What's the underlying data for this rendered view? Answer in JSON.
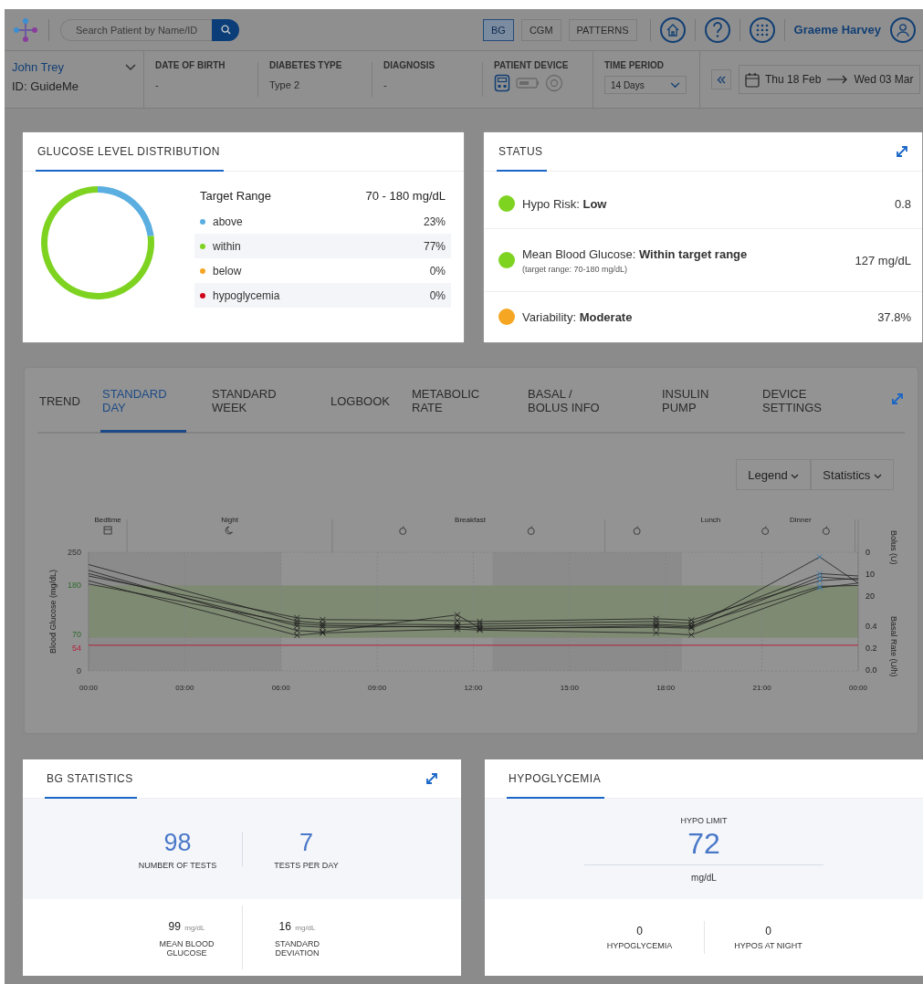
{
  "header": {
    "search": {
      "placeholder": "Search Patient by Name/ID"
    },
    "modes": [
      {
        "label": "BG",
        "selected": true
      },
      {
        "label": "CGM",
        "selected": false
      },
      {
        "label": "PATTERNS",
        "selected": false
      }
    ],
    "user": "Graeme Harvey"
  },
  "patient": {
    "name": "John Trey",
    "id": "ID: GuideMe",
    "fields": [
      {
        "label": "DATE OF BIRTH",
        "value": "-"
      },
      {
        "label": "DIABETES TYPE",
        "value": "Type 2"
      },
      {
        "label": "DIAGNOSIS",
        "value": "-"
      }
    ],
    "device_label": "PATIENT DEVICE",
    "devices": [
      {
        "kind": "meter",
        "active": true
      },
      {
        "kind": "pump",
        "active": false
      },
      {
        "kind": "sensor",
        "active": false
      }
    ],
    "time_period": {
      "label": "TIME PERIOD",
      "value": "14 Days"
    },
    "date_from": "Thu 18 Feb",
    "date_to": "Wed 03 Mar"
  },
  "distribution": {
    "title": "GLUCOSE LEVEL DISTRIBUTION",
    "target_label": "Target Range",
    "target_value": "70 - 180 mg/dL",
    "chart_data": {
      "type": "donut",
      "categories": [
        "above",
        "within",
        "below",
        "hypoglycemia"
      ],
      "series": [
        {
          "values": [
            23,
            77,
            0,
            0
          ]
        }
      ]
    },
    "items": [
      {
        "value": "23%",
        "color": "#5aaee0"
      },
      {
        "value": "77%",
        "color": "#7ed321"
      },
      {
        "value": "0%",
        "color": "#f5a623"
      },
      {
        "value": "0%",
        "color": "#d0021b"
      }
    ]
  },
  "status": {
    "title": "STATUS",
    "items": [
      {
        "label": "Hypo Risk: **Low**",
        "value": "0.8",
        "color": "#7ed321"
      },
      {
        "label": "Mean Blood Glucose: **Within target range**",
        "note": "(target range: 70-180 mg/dL)",
        "value": "127 mg/dL",
        "color": "#7ed321"
      },
      {
        "label": "Variability: **Moderate**",
        "value": "37.8%",
        "color": "#f5a623"
      }
    ]
  },
  "report": {
    "tabs": [
      {
        "label": "TREND",
        "selected": false
      },
      {
        "label": "STANDARD DAY",
        "selected": true
      },
      {
        "label": "STANDARD WEEK",
        "selected": false
      },
      {
        "label": "LOGBOOK",
        "selected": false
      },
      {
        "label": "METABOLIC RATE",
        "selected": false
      },
      {
        "label": "BASAL / BOLUS INFO",
        "selected": false
      },
      {
        "label": "INSULIN PUMP",
        "selected": false
      },
      {
        "label": "DEVICE SETTINGS",
        "selected": false
      }
    ],
    "dropdowns": [
      "Legend",
      "Statistics"
    ],
    "periods": [
      {
        "label": "Bedtime",
        "kind": "bed"
      },
      {
        "label": "Night",
        "kind": "moon"
      },
      {
        "label": "Breakfast",
        "kind": "meal"
      },
      {
        "label": "Lunch",
        "kind": "meal"
      },
      {
        "label": "Dinner",
        "kind": "meal"
      }
    ],
    "right_axis": {
      "bolus_label": "Bolus (U)",
      "bolus_ticks": [
        "0",
        "10",
        "20"
      ],
      "basal_label": "Basal Rate (U/h)",
      "basal_ticks": [
        "0.4",
        "0.2",
        "0.0"
      ]
    },
    "chart_data": {
      "type": "line",
      "ylabel": "Blood Glucose (mg/dL)",
      "x": [
        0,
        6.5,
        7.3,
        11.5,
        12.2,
        17.7,
        18.8,
        22.8,
        24
      ],
      "xticks": [
        {
          "value": 0,
          "label": "00:00"
        },
        {
          "value": 3,
          "label": "03:00"
        },
        {
          "value": 6,
          "label": "06:00"
        },
        {
          "value": 9,
          "label": "09:00"
        },
        {
          "value": 12,
          "label": "12:00"
        },
        {
          "value": 15,
          "label": "15:00"
        },
        {
          "value": 18,
          "label": "18:00"
        },
        {
          "value": 21,
          "label": "21:00"
        },
        {
          "value": 24,
          "label": "00:00"
        }
      ],
      "yticks": [
        0,
        54,
        70,
        180,
        250
      ],
      "ylim": [
        0,
        250
      ],
      "xlim": [
        0,
        24
      ],
      "grid": true,
      "bands": [
        {
          "axis": "x",
          "from": 0,
          "to": 6,
          "color": "#8b8b8b"
        },
        {
          "axis": "x",
          "from": 12.6,
          "to": 18.5,
          "color": "#8b8b8b"
        },
        {
          "axis": "y",
          "from": 70,
          "to": 180,
          "color": "#7f8a73"
        }
      ],
      "ref_lines": [
        {
          "axis": "y",
          "value": 54,
          "color": "#b3203a"
        }
      ],
      "series": [
        {
          "values": [
            224,
            105,
            100,
            97,
            99,
            104,
            100,
            205,
            200
          ]
        },
        {
          "values": [
            200,
            112,
            108,
            106,
            104,
            110,
            107,
            190,
            195
          ]
        },
        {
          "values": [
            205,
            95,
            92,
            94,
            88,
            95,
            92,
            240,
            185
          ]
        },
        {
          "values": [
            190,
            75,
            80,
            88,
            86,
            80,
            76,
            175,
            185
          ]
        },
        {
          "values": [
            183,
            100,
            96,
            92,
            94,
            98,
            95,
            178,
            180
          ]
        },
        {
          "values": [
            212,
            85,
            82,
            118,
            90,
            92,
            90,
            198,
            192
          ]
        }
      ]
    }
  },
  "bg_stats": {
    "title": "BG STATISTICS",
    "top": [
      {
        "value": "98",
        "label": "NUMBER OF TESTS"
      },
      {
        "value": "7",
        "label": "TESTS PER DAY"
      }
    ],
    "bottom": [
      {
        "value": "99",
        "unit": "mg/dL",
        "label": "MEAN BLOOD GLUCOSE"
      },
      {
        "value": "16",
        "unit": "mg/dL",
        "label": "STANDARD DEVIATION"
      }
    ]
  },
  "hypo": {
    "title": "HYPOGLYCEMIA",
    "limit_label": "HYPO LIMIT",
    "limit": "72",
    "unit": "mg/dL",
    "bottom": [
      {
        "value": "0",
        "label": "HYPOGLYCEMIA"
      },
      {
        "value": "0",
        "label": "HYPOS AT NIGHT"
      }
    ]
  }
}
